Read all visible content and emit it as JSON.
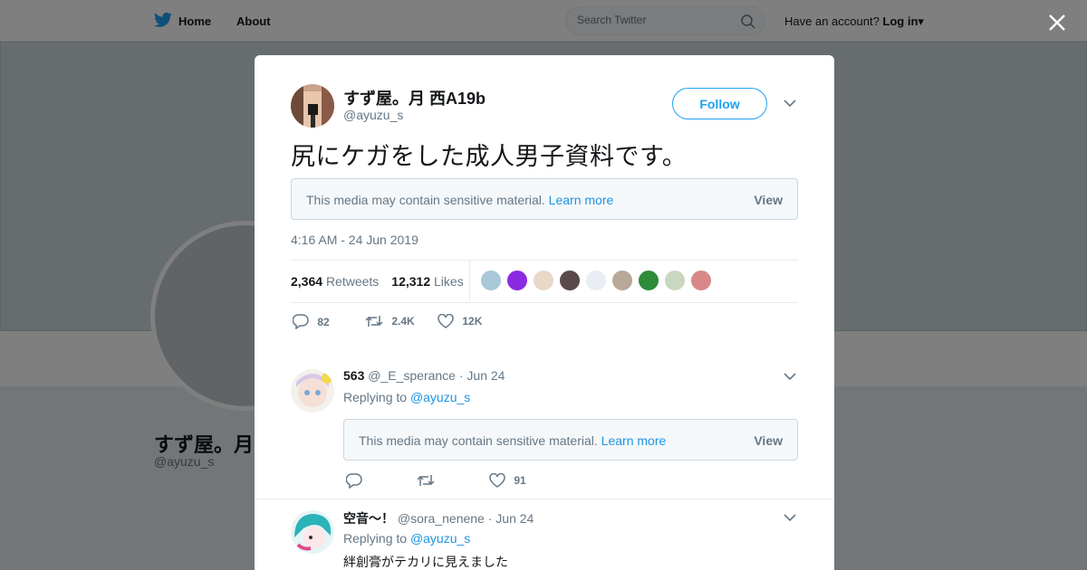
{
  "header": {
    "home_label": "Home",
    "about_label": "About",
    "search_placeholder": "Search Twitter",
    "have_account": "Have an account?",
    "login_label": "Log in"
  },
  "background_profile": {
    "name": "すず屋。月",
    "handle": "@ayuzu_s"
  },
  "tweet": {
    "author_name": "すず屋。月 西A19b",
    "author_handle": "@ayuzu_s",
    "follow_label": "Follow",
    "text": "尻にケガをした成人男子資料です。",
    "sensitive_message": "This media may contain sensitive material.",
    "learn_more": "Learn more",
    "view_label": "View",
    "timestamp": "4:16 AM - 24 Jun 2019",
    "retweets_count": "2,364",
    "retweets_label": "Retweets",
    "likes_count": "12,312",
    "likes_label": "Likes",
    "reply_count": "82",
    "retweet_short": "2.4K",
    "like_short": "12K",
    "liker_colors": [
      "#a9c8d8",
      "#8a2be2",
      "#e8d8c8",
      "#5a4a4a",
      "#e8eef4",
      "#b8a898",
      "#2e8b3a",
      "#c8d8c0",
      "#d88888"
    ]
  },
  "replies": [
    {
      "name": "563",
      "handle": "@_E_sperance",
      "date": "· Jun 24",
      "replying_to_label": "Replying to",
      "replying_to": "@ayuzu_s",
      "sensitive_message": "This media may contain sensitive material.",
      "learn_more": "Learn more",
      "view_label": "View",
      "like_count": "91"
    },
    {
      "name": "空音〜！",
      "handle": "@sora_nenene",
      "date": "· Jun 24",
      "replying_to_label": "Replying to",
      "replying_to": "@ayuzu_s",
      "text": "絆創膏がテカリに見えました"
    }
  ]
}
